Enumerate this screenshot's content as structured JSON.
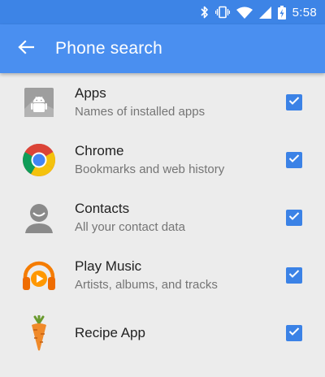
{
  "status_bar": {
    "time": "5:58",
    "icons": [
      "bluetooth-icon",
      "vibrate-icon",
      "wifi-icon",
      "cellular-signal-icon",
      "battery-charging-icon"
    ]
  },
  "app_bar": {
    "title": "Phone search",
    "back_icon": "arrow-back-icon"
  },
  "colors": {
    "status_bar": "#3d84e6",
    "app_bar": "#4a8ff0",
    "checkbox": "#3b82e6",
    "background": "#ececec"
  },
  "items": [
    {
      "title": "Apps",
      "subtitle": "Names of installed apps",
      "icon": "android-apps-icon",
      "checked": true
    },
    {
      "title": "Chrome",
      "subtitle": "Bookmarks and web history",
      "icon": "chrome-icon",
      "checked": true
    },
    {
      "title": "Contacts",
      "subtitle": "All your contact data",
      "icon": "contacts-icon",
      "checked": true
    },
    {
      "title": "Play Music",
      "subtitle": "Artists, albums, and tracks",
      "icon": "play-music-icon",
      "checked": true
    },
    {
      "title": "Recipe App",
      "subtitle": "",
      "icon": "carrot-icon",
      "checked": true
    }
  ]
}
